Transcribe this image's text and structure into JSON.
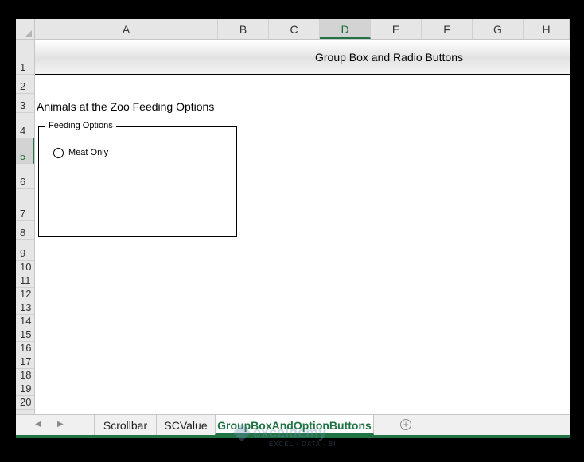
{
  "columns": [
    "A",
    "B",
    "C",
    "D",
    "E",
    "F",
    "G",
    "H"
  ],
  "active_column": "D",
  "rows": [
    "1",
    "2",
    "3",
    "4",
    "5",
    "6",
    "7",
    "8",
    "9",
    "10",
    "11",
    "12",
    "13",
    "14",
    "15",
    "16",
    "17",
    "18",
    "19",
    "20"
  ],
  "active_row": "5",
  "sheet": {
    "title": "Group Box and Radio Buttons",
    "cell_a3": "Animals at the Zoo Feeding Options"
  },
  "group_box": {
    "label": "Feeding Options",
    "option_label": "Meat Only",
    "option_selected": false
  },
  "tabs": {
    "items": [
      "Scrollbar",
      "SCValue",
      "GroupBoxAndOptionButtons"
    ],
    "active": "GroupBoxAndOptionButtons",
    "prev_arrow": "◀",
    "next_arrow": "▶",
    "add_symbol": "+"
  },
  "watermark": {
    "name": "exceldemy",
    "tagline": "EXCEL · DATA · BI"
  },
  "colors": {
    "accent": "#217346",
    "header_bg": "#e6e6e6",
    "frame": "#000000"
  }
}
